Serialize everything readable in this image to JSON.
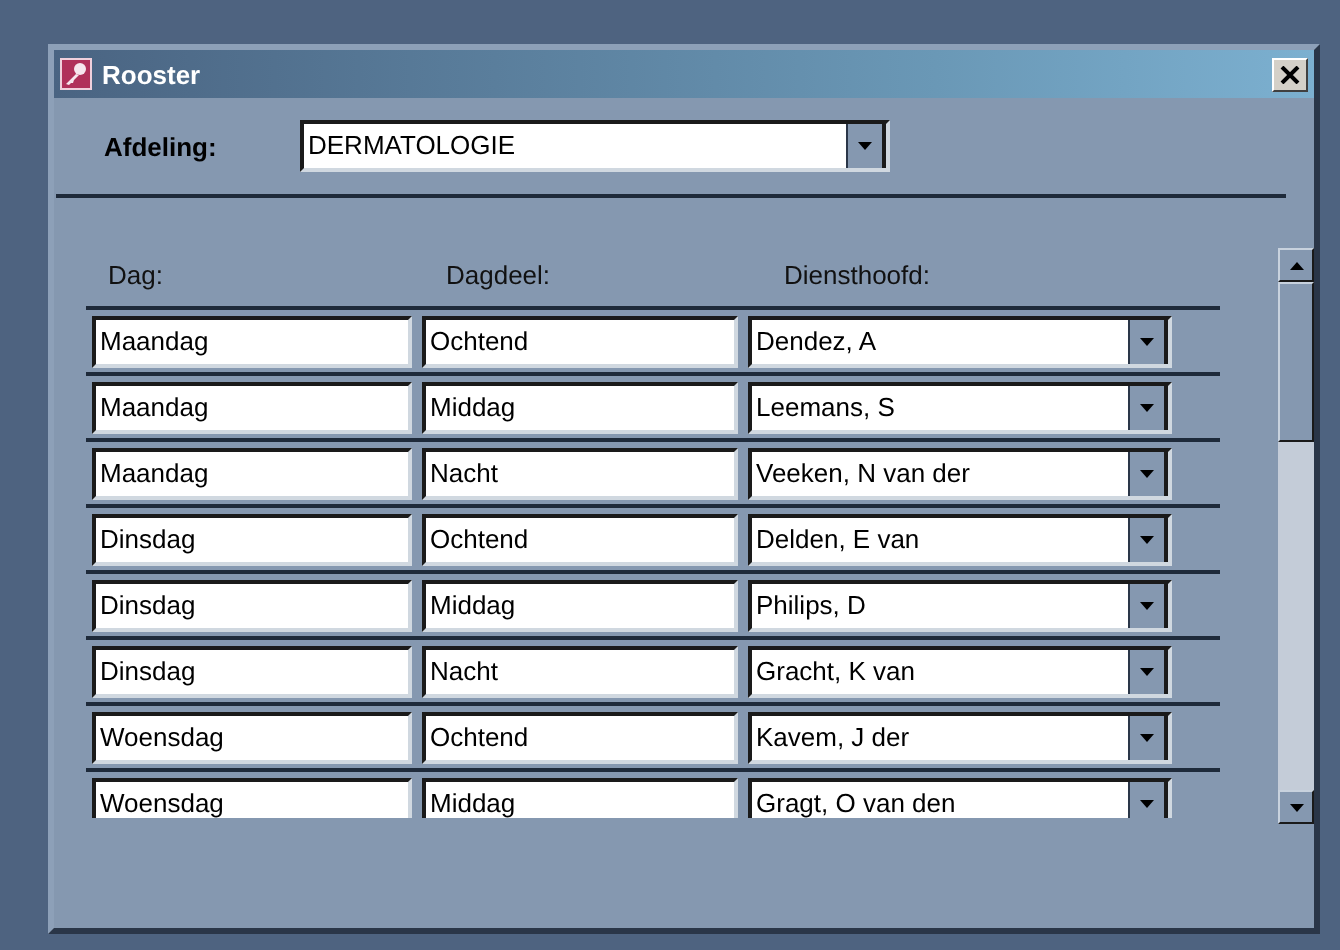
{
  "window": {
    "title": "Rooster"
  },
  "afdeling": {
    "label": "Afdeling:",
    "value": "DERMATOLOGIE"
  },
  "table": {
    "columns": [
      "Dag:",
      "Dagdeel:",
      "Diensthoofd:"
    ],
    "rows": [
      {
        "dag": "Maandag",
        "dagdeel": "Ochtend",
        "diensthoofd": "Dendez, A"
      },
      {
        "dag": "Maandag",
        "dagdeel": "Middag",
        "diensthoofd": "Leemans, S"
      },
      {
        "dag": "Maandag",
        "dagdeel": "Nacht",
        "diensthoofd": "Veeken, N van der"
      },
      {
        "dag": "Dinsdag",
        "dagdeel": "Ochtend",
        "diensthoofd": "Delden, E van"
      },
      {
        "dag": "Dinsdag",
        "dagdeel": "Middag",
        "diensthoofd": "Philips, D"
      },
      {
        "dag": "Dinsdag",
        "dagdeel": "Nacht",
        "diensthoofd": "Gracht, K van"
      },
      {
        "dag": "Woensdag",
        "dagdeel": "Ochtend",
        "diensthoofd": "Kavem, J der"
      },
      {
        "dag": "Woensdag",
        "dagdeel": "Middag",
        "diensthoofd": "Gragt, O van den"
      }
    ]
  }
}
